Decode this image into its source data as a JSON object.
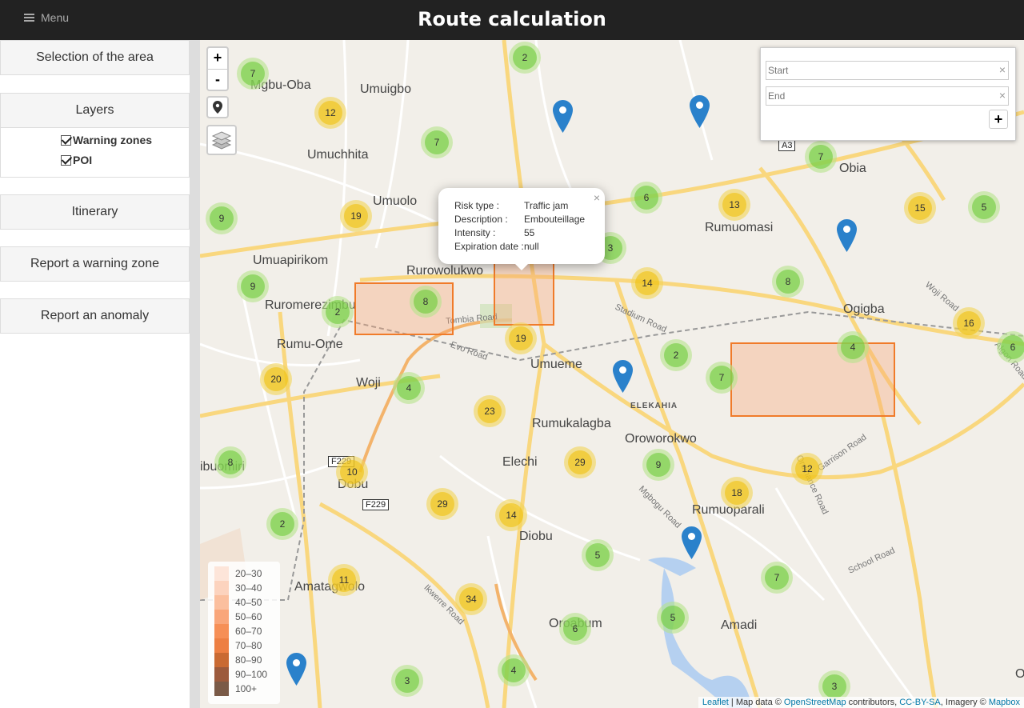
{
  "header": {
    "title": "Route calculation",
    "menu_label": "Menu"
  },
  "sidebar": {
    "selection": "Selection of the area",
    "layers": "Layers",
    "layer_items": [
      "Warning zones",
      "POI"
    ],
    "itinerary": "Itinerary",
    "report_zone": "Report a warning zone",
    "report_anomaly": "Report an anomaly"
  },
  "controls": {
    "zoom_in": "+",
    "zoom_out": "-"
  },
  "route": {
    "start_placeholder": "Start",
    "end_placeholder": "End",
    "clear": "×",
    "add": "+"
  },
  "popup": {
    "close": "×",
    "risk_type_label": "Risk type :",
    "risk_type": "Traffic jam",
    "description_label": "Description :",
    "description": "Embouteillage",
    "intensity_label": "Intensity :",
    "intensity": "55",
    "expiration_label": "Expiration date :",
    "expiration": "null"
  },
  "legend": [
    {
      "label": "20–30",
      "color": "#fde5d9"
    },
    {
      "label": "30–40",
      "color": "#fcd3be"
    },
    {
      "label": "40–50",
      "color": "#fbbf9e"
    },
    {
      "label": "50–60",
      "color": "#f9a67a"
    },
    {
      "label": "60–70",
      "color": "#f68f56"
    },
    {
      "label": "70–80",
      "color": "#ed7f43"
    },
    {
      "label": "80–90",
      "color": "#c96a33"
    },
    {
      "label": "90–100",
      "color": "#9c5a3c"
    },
    {
      "label": "100+",
      "color": "#7a5a47"
    }
  ],
  "places": [
    "Mgbu-Oba",
    "Umuigbo",
    "Umuchhita",
    "Umuolo",
    "Umuapirikom",
    "Rurowolukwo",
    "Ruromerezimbu",
    "Rumu-Ome",
    "Woji",
    "Umueme",
    "Rumukalagba",
    "Elechi",
    "Oroworokwo",
    "Dobu",
    "Rumuoparali",
    "Diobu",
    "Amatagwolo",
    "Oroabum",
    "Amadi",
    "Obia",
    "Rumuomasi",
    "Ogigba",
    "ELEKAHIA",
    "ibuomiri",
    "Ok"
  ],
  "roads": [
    "Tombia Road",
    "Evo Road",
    "Stadium Road",
    "Woji Road",
    "Algon Road",
    "Garrison Road",
    "Ordinance Road",
    "Mgbogu Road",
    "School Road",
    "Ikwerre Road"
  ],
  "shields": [
    "A3",
    "F229",
    "F229"
  ],
  "clusters": [
    "2",
    "7",
    "12",
    "7",
    "9",
    "19",
    "6",
    "13",
    "15",
    "5",
    "7",
    "3",
    "8",
    "14",
    "9",
    "2",
    "8",
    "19",
    "16",
    "4",
    "6",
    "20",
    "4",
    "23",
    "2",
    "7",
    "29",
    "9",
    "8",
    "10",
    "12",
    "18",
    "29",
    "14",
    "2",
    "5",
    "11",
    "34",
    "7",
    "5",
    "6",
    "4",
    "3",
    "3"
  ],
  "attribution": {
    "leaflet": "Leaflet",
    "sep1": " | Map data © ",
    "osm": "OpenStreetMap",
    "sep2": " contributors, ",
    "license": "CC-BY-SA",
    "sep3": ", Imagery © ",
    "mapbox": "Mapbox"
  },
  "colors": {
    "zone_border": "#f07b2a",
    "marker": "#2a81cb",
    "header": "#222222"
  }
}
